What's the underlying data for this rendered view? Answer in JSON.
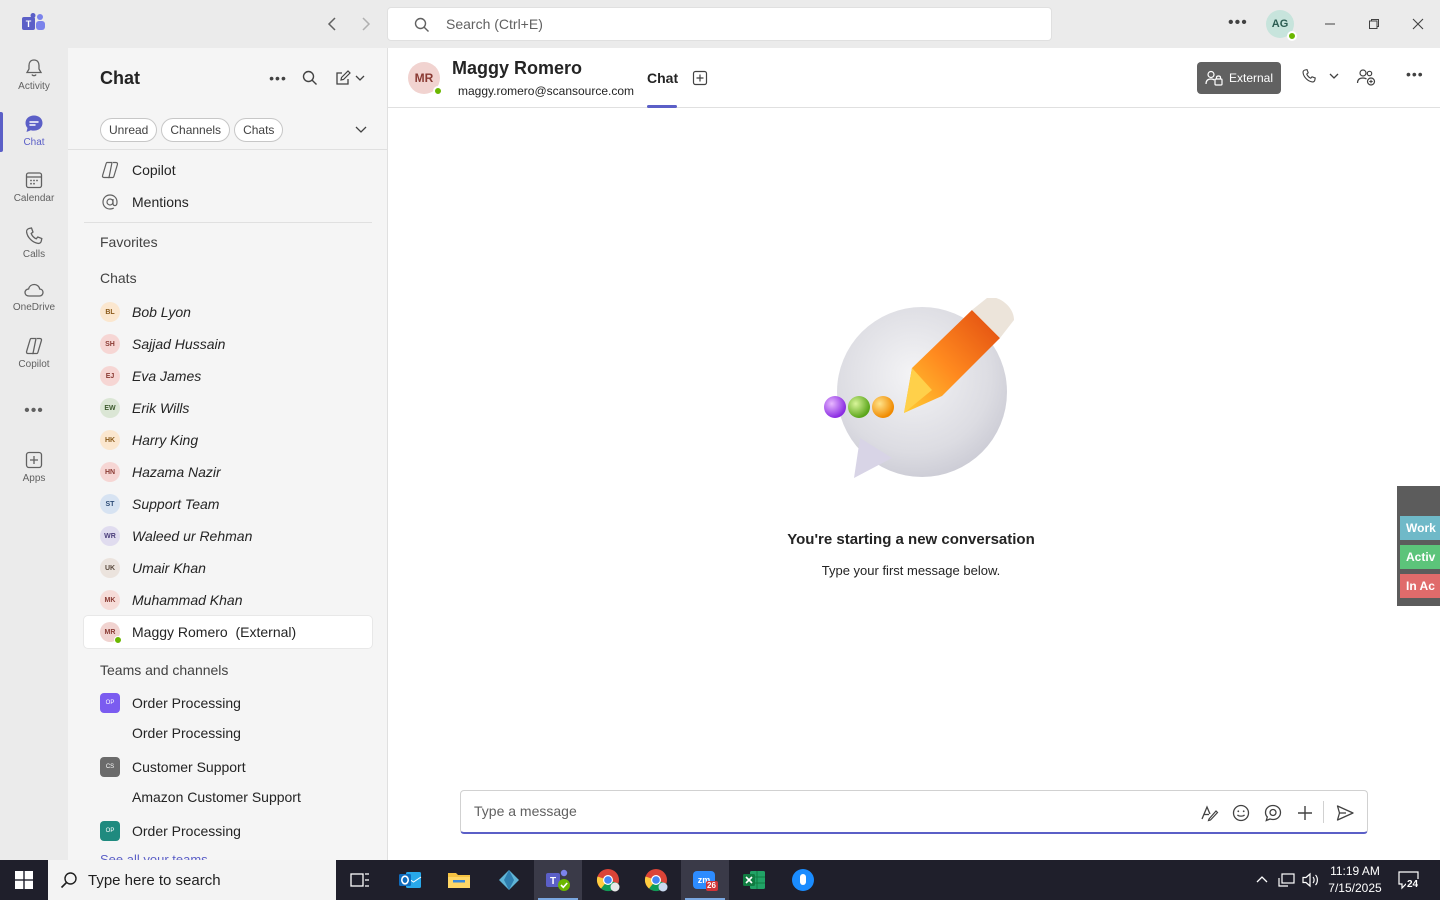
{
  "titlebar": {
    "search_placeholder": "Search (Ctrl+E)",
    "user_initials": "AG"
  },
  "rail": {
    "items": [
      {
        "label": "Activity",
        "icon": "bell-icon"
      },
      {
        "label": "Chat",
        "icon": "chat-icon"
      },
      {
        "label": "Calendar",
        "icon": "calendar-icon"
      },
      {
        "label": "Calls",
        "icon": "phone-icon"
      },
      {
        "label": "OneDrive",
        "icon": "cloud-icon"
      },
      {
        "label": "Copilot",
        "icon": "copilot-icon"
      },
      {
        "label": "Apps",
        "icon": "add-app-icon"
      }
    ]
  },
  "chatpane": {
    "title": "Chat",
    "filters": [
      "Unread",
      "Channels",
      "Chats"
    ],
    "nav": [
      {
        "label": "Copilot"
      },
      {
        "label": "Mentions"
      }
    ],
    "favorites_label": "Favorites",
    "chats_label": "Chats",
    "chats": [
      {
        "initials": "BL",
        "name": "Bob Lyon",
        "bg": "#fbe7cf",
        "fg": "#8a5a1a"
      },
      {
        "initials": "SH",
        "name": "Sajjad Hussain",
        "bg": "#f6d6d4",
        "fg": "#8a3a33"
      },
      {
        "initials": "EJ",
        "name": "Eva James",
        "bg": "#f6d6d4",
        "fg": "#8a3a33"
      },
      {
        "initials": "EW",
        "name": "Erik Wills",
        "bg": "#dbe6d5",
        "fg": "#3d5a2e"
      },
      {
        "initials": "HK",
        "name": "Harry King",
        "bg": "#fbe7cf",
        "fg": "#8a5a1a"
      },
      {
        "initials": "HN",
        "name": "Hazama Nazir",
        "bg": "#f6d6d4",
        "fg": "#8a3a33"
      },
      {
        "initials": "ST",
        "name": "Support Team",
        "bg": "#d7e3f2",
        "fg": "#2b4a75"
      },
      {
        "initials": "WR",
        "name": "Waleed ur Rehman",
        "bg": "#e0dcef",
        "fg": "#4a3d7a"
      },
      {
        "initials": "UK",
        "name": "Umair Khan",
        "bg": "#ebe3dd",
        "fg": "#5a4a3d"
      },
      {
        "initials": "MK",
        "name": "Muhammad Khan",
        "bg": "#f6dcd8",
        "fg": "#8a3a33"
      },
      {
        "initials": "MR",
        "name": "Maggy Romero  (External)",
        "bg": "#f1d3d0",
        "fg": "#8a3a33"
      }
    ],
    "teams_label": "Teams and channels",
    "teams": [
      {
        "initials": "OP",
        "name": "Order Processing",
        "color": "#7b5cf0",
        "channel": "Order Processing"
      },
      {
        "initials": "CS",
        "name": "Customer Support",
        "color": "#6b6b6b",
        "channel": "Amazon Customer Support"
      },
      {
        "initials": "OP",
        "name": "Order Processing",
        "color": "#1f8a7f",
        "channel": ""
      }
    ],
    "see_all": "See all your teams"
  },
  "conversation": {
    "contact_initials": "MR",
    "contact_name": "Maggy Romero",
    "contact_email": "maggy.romero@scansource.com",
    "tab_label": "Chat",
    "external_label": "External",
    "empty_title": "You're starting a new conversation",
    "empty_subtitle": "Type your first message below.",
    "composer_placeholder": "Type a message",
    "side_tabs": [
      {
        "label": "Work",
        "color": "#6fb9c8"
      },
      {
        "label": "Activ",
        "color": "#5cc47a"
      },
      {
        "label": "In Ac",
        "color": "#e06b6b"
      }
    ]
  },
  "taskbar": {
    "search_placeholder": "Type here to search",
    "time": "11:19 AM",
    "date": "7/15/2025",
    "notifications": "24",
    "zoom_badge": "26"
  }
}
